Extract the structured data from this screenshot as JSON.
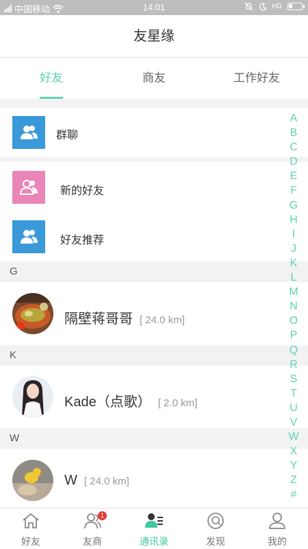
{
  "status_bar": {
    "carrier": "中国移动",
    "time": "14:01",
    "hd": "HD"
  },
  "header": {
    "title": "友星缘"
  },
  "tabs": [
    {
      "label": "好友"
    },
    {
      "label": "商友"
    },
    {
      "label": "工作好友"
    }
  ],
  "shortcuts": {
    "group_chat": {
      "label": "群聊",
      "icon": "group-icon",
      "color": "#3a99d8"
    },
    "new_friends": {
      "label": "新的好友",
      "icon": "add-friend-icon",
      "color": "#ea85b8"
    },
    "recommend": {
      "label": "好友推荐",
      "icon": "group-icon",
      "color": "#3a99d8"
    }
  },
  "sections": [
    {
      "letter": "G",
      "friends": [
        {
          "name": "隔壁蒋哥哥",
          "distance": "[ 24.0 km]"
        }
      ]
    },
    {
      "letter": "K",
      "friends": [
        {
          "name": "Kade（点歌）",
          "distance": "[ 2.0 km]"
        }
      ]
    },
    {
      "letter": "W",
      "friends": [
        {
          "name": "W",
          "distance": "[ 24.0 km]"
        }
      ]
    }
  ],
  "index": [
    "A",
    "B",
    "C",
    "D",
    "E",
    "F",
    "G",
    "H",
    "I",
    "J",
    "K",
    "L",
    "M",
    "N",
    "O",
    "P",
    "Q",
    "R",
    "S",
    "T",
    "U",
    "V",
    "W",
    "X",
    "Y",
    "Z",
    "#"
  ],
  "bottom_nav": [
    {
      "label": "好友",
      "icon": "home-icon"
    },
    {
      "label": "友商",
      "icon": "contacts-icon",
      "badge": "1"
    },
    {
      "label": "通讯录",
      "icon": "address-book-icon"
    },
    {
      "label": "发现",
      "icon": "discover-icon"
    },
    {
      "label": "我的",
      "icon": "profile-icon"
    }
  ],
  "colors": {
    "accent": "#5fd3b3",
    "blue_tile": "#3a99d8",
    "pink_tile": "#ea85b8",
    "badge": "#e53935"
  }
}
